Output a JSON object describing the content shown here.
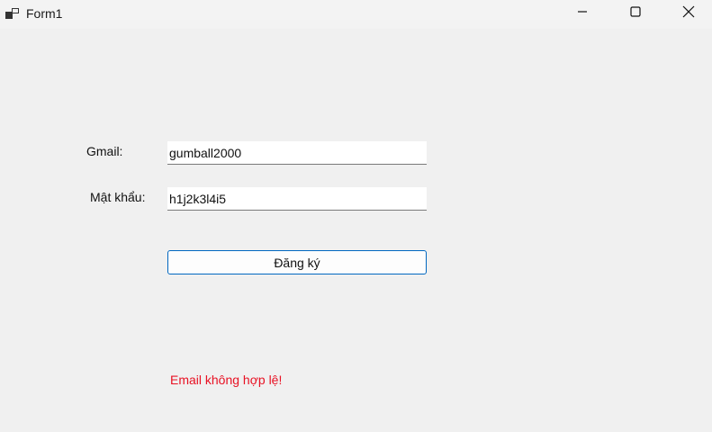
{
  "window": {
    "title": "Form1"
  },
  "titlebar_buttons": {
    "minimize_icon": "minimize-icon",
    "maximize_icon": "maximize-icon",
    "close_icon": "close-icon"
  },
  "form": {
    "gmail_label": "Gmail:",
    "gmail_value": "gumball2000",
    "password_label": "Mật khẩu:",
    "password_value": "h1j2k3l4i5",
    "register_button_label": "Đăng ký",
    "error_message": "Email không hợp lệ!"
  },
  "colors": {
    "error": "#e81123",
    "button_border": "#0067c0",
    "background": "#f0f0f0"
  }
}
